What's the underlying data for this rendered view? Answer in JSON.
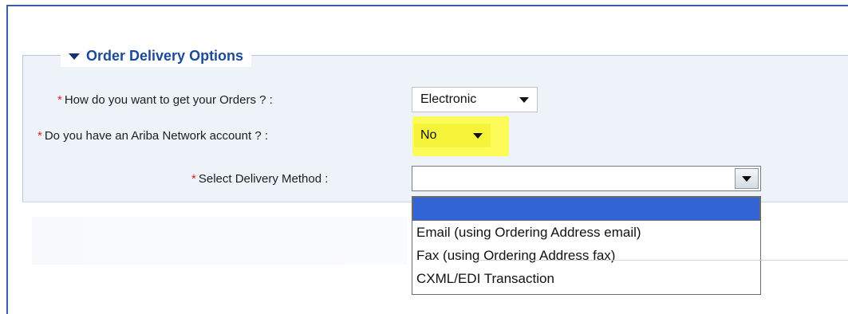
{
  "section": {
    "title": "Order Delivery Options"
  },
  "fields": {
    "orders": {
      "required_mark": "*",
      "label": "How do you want to get your Orders ? :",
      "value": "Electronic"
    },
    "ariba": {
      "required_mark": "*",
      "label": "Do you have an Ariba Network account ? :",
      "value": "No"
    },
    "delivery": {
      "required_mark": "*",
      "label": "Select Delivery Method :",
      "value": ""
    }
  },
  "delivery_options": [
    {
      "label": ""
    },
    {
      "label": "Email (using Ordering Address email)"
    },
    {
      "label": "Fax (using Ordering Address fax)"
    },
    {
      "label": "CXML/EDI Transaction"
    }
  ],
  "colors": {
    "frame_border": "#3a5ea8",
    "legend_text": "#1c4a99",
    "required": "#d9261c",
    "highlight": "#fffb3b",
    "selected_option": "#3264d4"
  },
  "icons": {
    "legend": "triangle-down-icon",
    "select_caret": "chevron-down-icon"
  }
}
